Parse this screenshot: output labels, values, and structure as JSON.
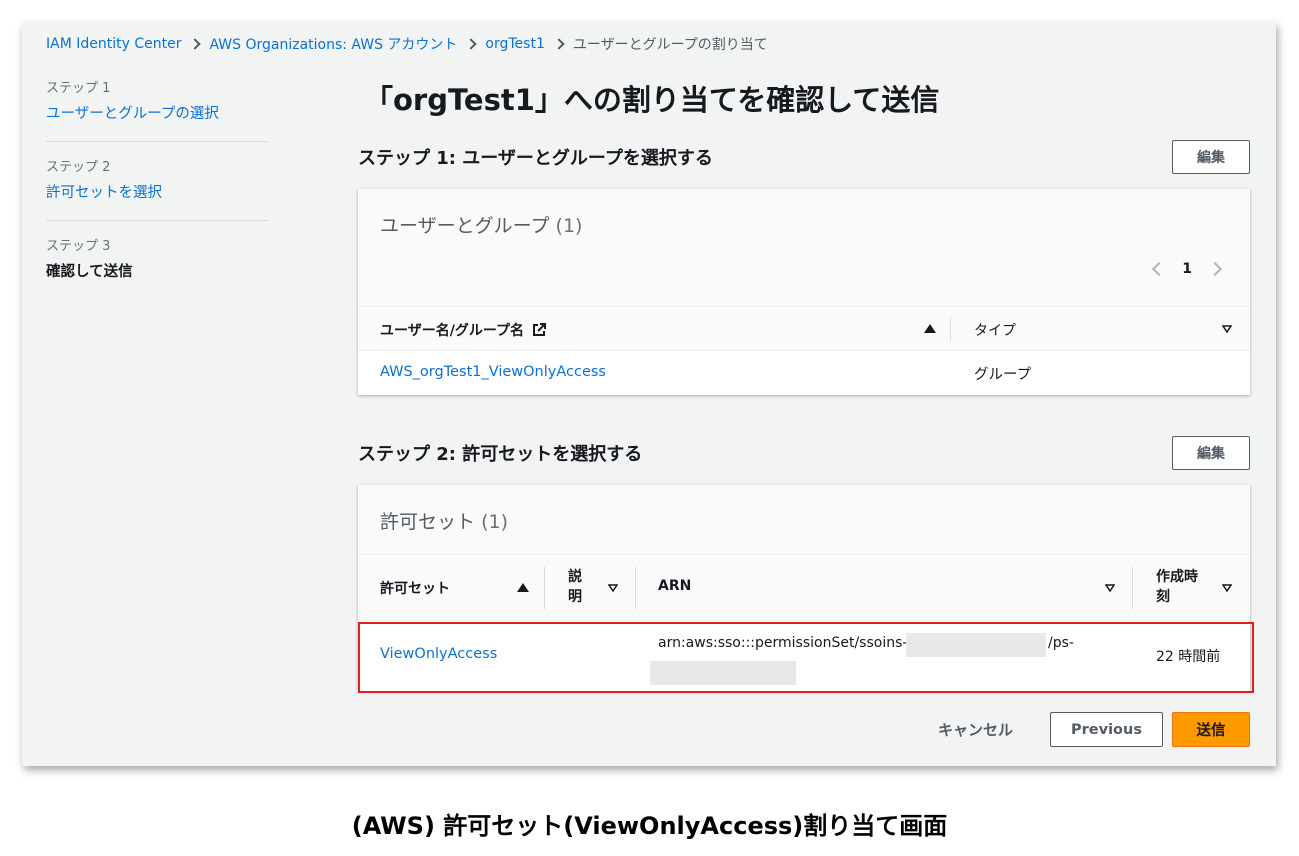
{
  "breadcrumb": {
    "items": [
      "IAM Identity Center",
      "AWS Organizations: AWS アカウント",
      "orgTest1"
    ],
    "current": "ユーザーとグループの割り当て"
  },
  "nav": {
    "steps": [
      {
        "num": "ステップ 1",
        "label": "ユーザーとグループの選択"
      },
      {
        "num": "ステップ 2",
        "label": "許可セットを選択"
      },
      {
        "num": "ステップ 3",
        "label": "確認して送信"
      }
    ]
  },
  "page_title": "「orgTest1」への割り当てを確認して送信",
  "step1": {
    "heading": "ステップ 1: ユーザーとグループを選択する",
    "edit_label": "編集",
    "card_title": "ユーザーとグループ",
    "count": "(1)",
    "page": "1",
    "columns": [
      "ユーザー名/グループ名",
      "タイプ"
    ],
    "rows": [
      {
        "name": "AWS_orgTest1_ViewOnlyAccess",
        "type": "グループ"
      }
    ]
  },
  "step2": {
    "heading": "ステップ 2: 許可セットを選択する",
    "edit_label": "編集",
    "card_title": "許可セット",
    "count": "(1)",
    "columns": {
      "name": "許可セット",
      "desc_1": "説",
      "desc_2": "明",
      "arn": "ARN",
      "created_1": "作成時",
      "created_2": "刻"
    },
    "rows": [
      {
        "name": "ViewOnlyAccess",
        "arn_prefix": "arn:aws:sso:::permissionSet/ssoins-",
        "arn_mid": "/ps-",
        "created": "22 時間前"
      }
    ]
  },
  "footer": {
    "cancel_label": "キャンセル",
    "previous_label": "Previous",
    "submit_label": "送信"
  },
  "caption": "(AWS) 許可セット(ViewOnlyAccess)割り当て画面",
  "colors": {
    "link": "#0972d3",
    "primary": "#ff9900",
    "highlight": "#e02020"
  }
}
